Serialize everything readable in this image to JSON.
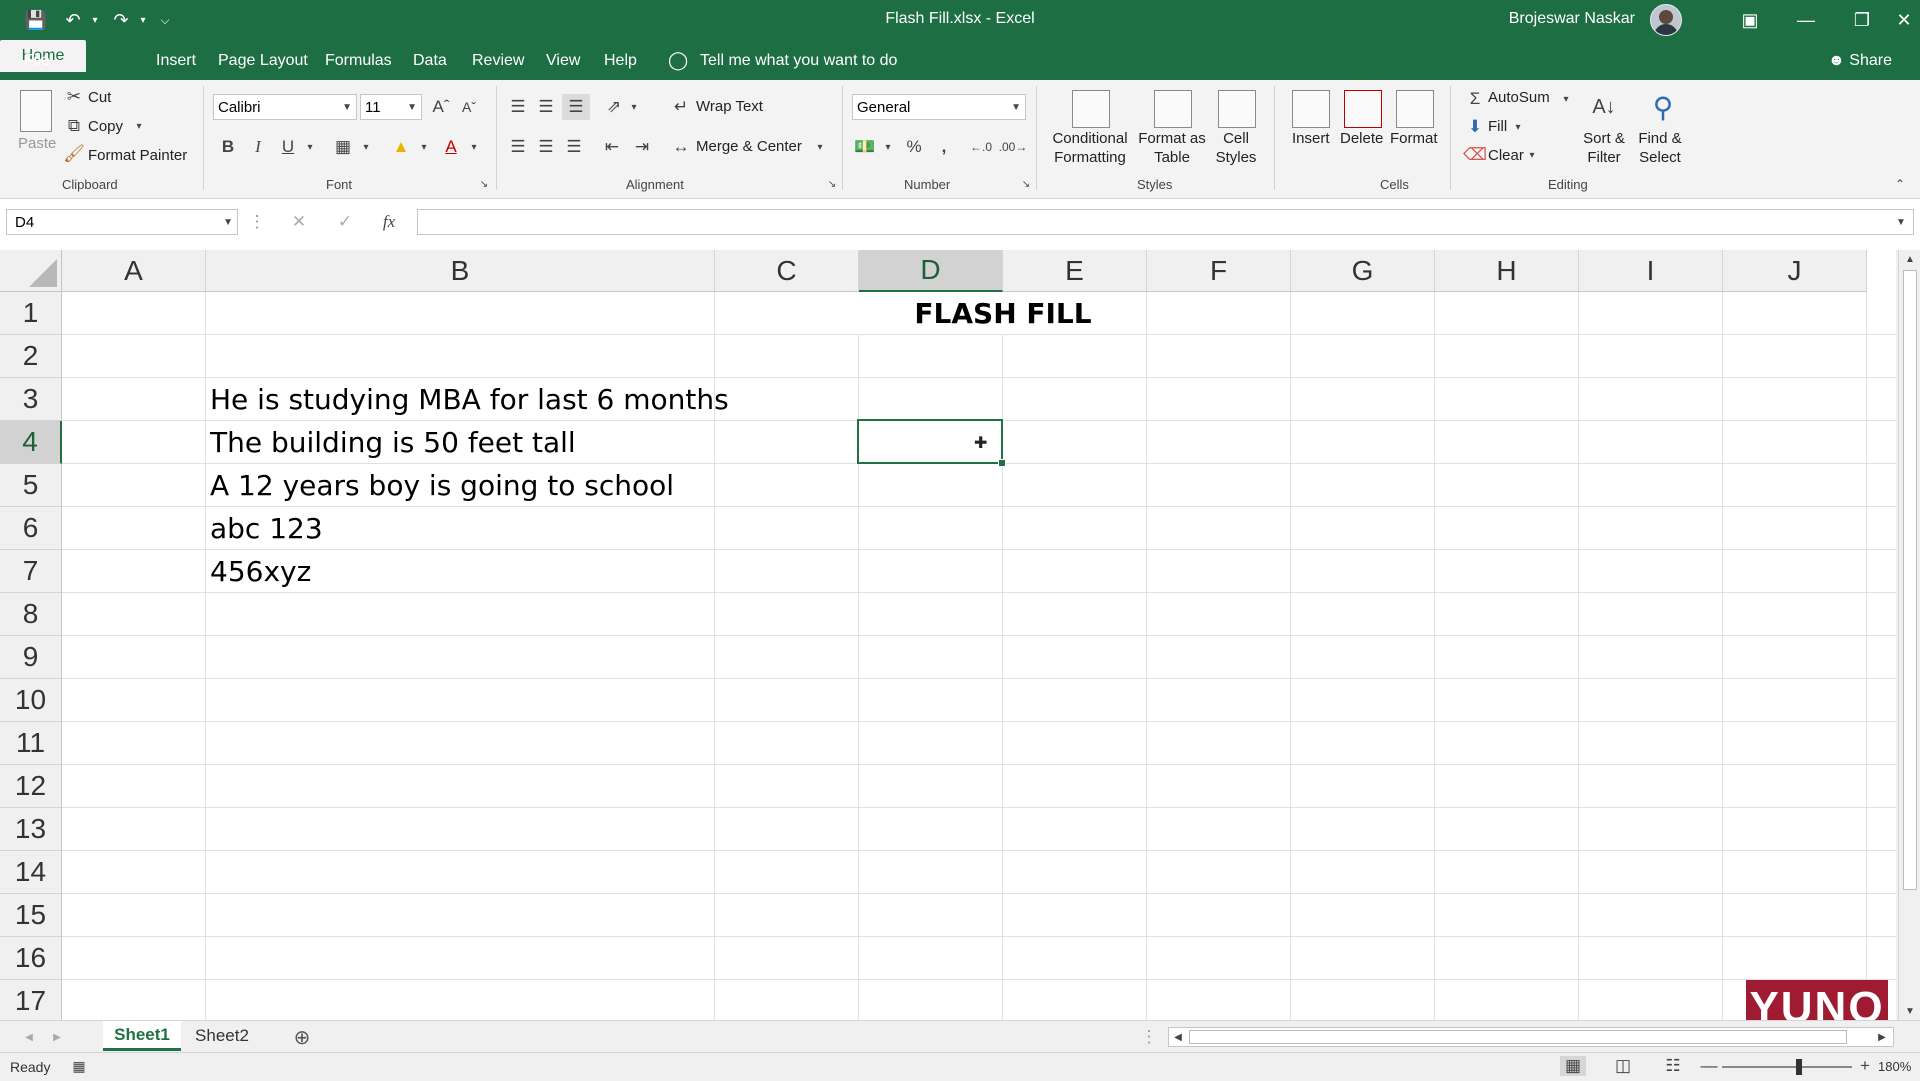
{
  "app": {
    "doc_title": "Flash Fill.xlsx  -  Excel",
    "user_name": "Brojeswar Naskar"
  },
  "tabs": [
    "File",
    "Home",
    "Insert",
    "Page Layout",
    "Formulas",
    "Data",
    "Review",
    "View",
    "Help"
  ],
  "tell_me": "Tell me what you want to do",
  "share": "Share",
  "ribbon": {
    "clipboard": {
      "paste": "Paste",
      "cut": "Cut",
      "copy": "Copy",
      "format_painter": "Format Painter",
      "group": "Clipboard"
    },
    "font": {
      "name": "Calibri",
      "size": "11",
      "group": "Font"
    },
    "alignment": {
      "wrap_text": "Wrap Text",
      "merge_center": "Merge & Center",
      "group": "Alignment"
    },
    "number": {
      "format": "General",
      "group": "Number"
    },
    "styles": {
      "conditional": [
        "Conditional",
        "Formatting"
      ],
      "format_table": [
        "Format as",
        "Table"
      ],
      "cell_styles": [
        "Cell",
        "Styles"
      ],
      "group": "Styles"
    },
    "cells": {
      "insert": "Insert",
      "delete": "Delete",
      "format": "Format",
      "group": "Cells"
    },
    "editing": {
      "autosum": "AutoSum",
      "fill": "Fill",
      "clear": "Clear",
      "sort": [
        "Sort &",
        "Filter"
      ],
      "find": [
        "Find &",
        "Select"
      ],
      "group": "Editing"
    }
  },
  "formula_bar": {
    "name_box": "D4",
    "fx": "fx",
    "value": ""
  },
  "grid": {
    "columns": [
      "A",
      "B",
      "C",
      "D",
      "E",
      "F",
      "G",
      "H",
      "I",
      "J"
    ],
    "rows": [
      "1",
      "2",
      "3",
      "4",
      "5",
      "6",
      "7",
      "8",
      "9",
      "10",
      "11",
      "12",
      "13",
      "14",
      "15",
      "16",
      "17"
    ],
    "title": "FLASH FILL",
    "b3": "He is studying MBA for last 6 months",
    "b4": "The building is 50 feet tall",
    "b5": "A 12 years boy is going to school",
    "b6": "abc 123",
    "b7": "456xyz"
  },
  "sheets": [
    "Sheet1",
    "Sheet2"
  ],
  "status": {
    "ready": "Ready",
    "zoom": "180%"
  },
  "watermark": "YUNO",
  "colors": {
    "excel_green": "#1e6e43",
    "ribbon_bg": "#f3f3f3",
    "selection": "#1f7244"
  }
}
